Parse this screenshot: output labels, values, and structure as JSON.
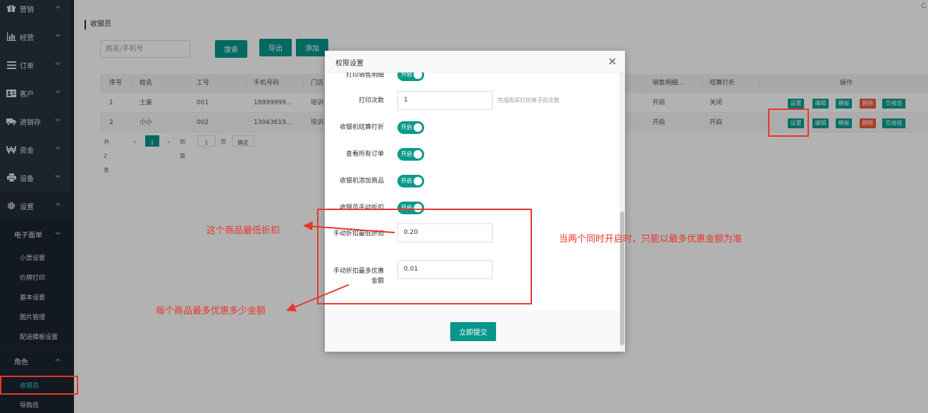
{
  "sidebar": {
    "items": [
      {
        "label": "营销",
        "icon": "gift-icon"
      },
      {
        "label": "经营",
        "icon": "bar-chart-icon"
      },
      {
        "label": "订单",
        "icon": "list-icon"
      },
      {
        "label": "客户",
        "icon": "id-card-icon"
      },
      {
        "label": "进销存",
        "icon": "truck-icon"
      },
      {
        "label": "资金",
        "icon": "won-icon"
      },
      {
        "label": "设备",
        "icon": "printer-icon"
      },
      {
        "label": "设置",
        "icon": "gear-icon"
      }
    ],
    "submenu_group": "电子面单",
    "sub_items": [
      "小票设置",
      "价牌打印",
      "基本设置",
      "图片管理",
      "配送模板设置"
    ],
    "role_group": "角色",
    "role_items": [
      "收银员",
      "导购员"
    ]
  },
  "main": {
    "page_title": "收银员",
    "search_placeholder": "姓名/手机号",
    "buttons": {
      "search": "搜索",
      "export": "导出",
      "add": "添加"
    },
    "table": {
      "headers": [
        "序号",
        "姓名",
        "工号",
        "手机号码",
        "门店",
        "销售明细...",
        "结算打折",
        "操作"
      ],
      "rows": [
        {
          "index": "1",
          "name": "土豪",
          "emp_no": "001",
          "phone": "18899999...",
          "store": "培训",
          "sales_detail": "开启",
          "checkout_discount": "关闭"
        },
        {
          "index": "2",
          "name": "小小",
          "emp_no": "002",
          "phone": "13043619...",
          "store": "培训",
          "sales_detail": "开启",
          "checkout_discount": "开启"
        }
      ],
      "actions": [
        "设置",
        "编辑",
        "模板",
        "删除",
        "交接班"
      ]
    },
    "pager": {
      "total": "共 2 条",
      "current_page": "1",
      "goto_label": "到第",
      "goto_value": "1",
      "page_unit": "页",
      "confirm": "确定"
    }
  },
  "dialog": {
    "title": "权限设置",
    "partial_row_label": "打印销售明细",
    "toggle_text": "开启",
    "print_count_label": "打印次数",
    "print_count_value": "1",
    "print_count_hint": "完成购买打印单子的次数",
    "toggles": [
      "收银机结算打折",
      "查看所有订单",
      "收银机添加商品",
      "收银员手动折扣"
    ],
    "min_discount_label": "手动折扣最低折扣",
    "min_discount_value": "0.20",
    "max_amount_label": "手动折扣最多优惠金额",
    "max_amount_value": "0.01",
    "submit": "立即提交"
  },
  "annotations": {
    "min_discount_note": "这个商品最低折扣",
    "max_amount_note": "每个商品最多优惠多少金额",
    "both_on_note": "当两个同时开启时，只能以最多优惠金额为准"
  },
  "colors": {
    "accent": "#06978a",
    "sidebar_bg": "#28333e",
    "annotation_red": "#e8362c",
    "delete_red": "#ee5b3a"
  }
}
